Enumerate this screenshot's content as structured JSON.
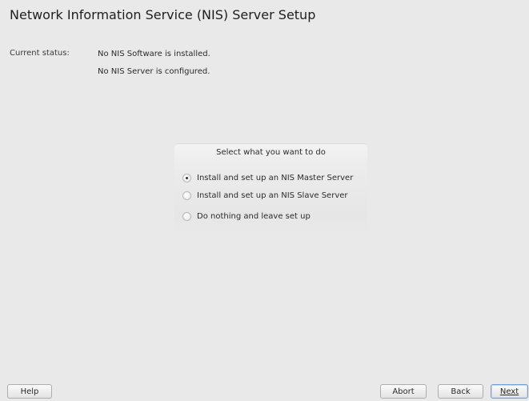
{
  "page": {
    "title": "Network Information Service (NIS) Server Setup"
  },
  "status": {
    "label": "Current status:",
    "lines": [
      "No NIS Software is installed.",
      "No NIS Server is configured."
    ]
  },
  "group": {
    "title": "Select what you want to do",
    "options": [
      {
        "label": "Install and set up an NIS Master Server",
        "checked": true
      },
      {
        "label": "Install and set up an NIS Slave Server",
        "checked": false
      },
      {
        "label": "Do nothing and leave set up",
        "checked": false
      }
    ]
  },
  "buttons": {
    "help": "Help",
    "abort": "Abort",
    "back": "Back",
    "next": "Next"
  }
}
